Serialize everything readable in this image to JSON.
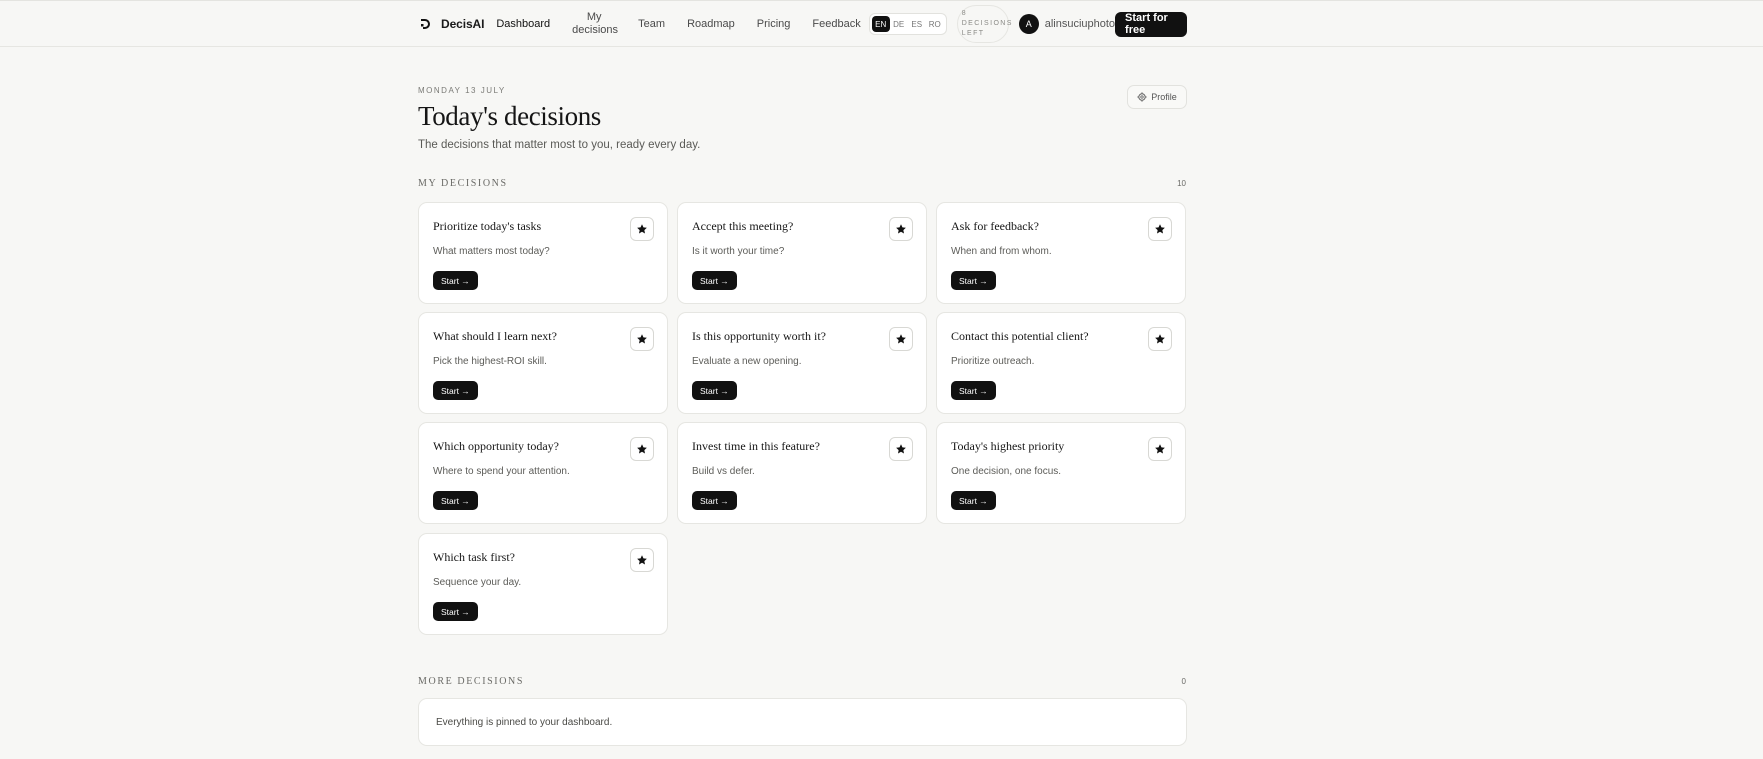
{
  "nav": {
    "brand": "DecisAI",
    "links": [
      {
        "label": "Dashboard"
      },
      {
        "label": "My decisions"
      },
      {
        "label": "Team"
      },
      {
        "label": "Roadmap"
      },
      {
        "label": "Pricing"
      },
      {
        "label": "Feedback"
      }
    ],
    "languages": [
      "EN",
      "DE",
      "ES",
      "RO"
    ],
    "active_language": "EN",
    "decisions_left_count": "8",
    "decisions_left_label_1": "DECISIONS",
    "decisions_left_label_2": "LEFT",
    "avatar_initial": "A",
    "username": "alinsuciuphoto",
    "cta_label": "Start for free"
  },
  "header": {
    "date": "MONDAY 13 JULY",
    "title": "Today's decisions",
    "subtitle": "The decisions that matter most to you, ready every day.",
    "profile_label": "Profile"
  },
  "my_decisions": {
    "label": "MY DECISIONS",
    "count": "10",
    "start_label": "Start →",
    "cards": [
      {
        "title": "Prioritize today's tasks",
        "subtitle": "What matters most today?"
      },
      {
        "title": "Accept this meeting?",
        "subtitle": "Is it worth your time?"
      },
      {
        "title": "Ask for feedback?",
        "subtitle": "When and from whom."
      },
      {
        "title": "What should I learn next?",
        "subtitle": "Pick the highest-ROI skill."
      },
      {
        "title": "Is this opportunity worth it?",
        "subtitle": "Evaluate a new opening."
      },
      {
        "title": "Contact this potential client?",
        "subtitle": "Prioritize outreach."
      },
      {
        "title": "Which opportunity today?",
        "subtitle": "Where to spend your attention."
      },
      {
        "title": "Invest time in this feature?",
        "subtitle": "Build vs defer."
      },
      {
        "title": "Today's highest priority",
        "subtitle": "One decision, one focus."
      },
      {
        "title": "Which task first?",
        "subtitle": "Sequence your day."
      }
    ]
  },
  "more_decisions": {
    "label": "MORE DECISIONS",
    "count": "0",
    "empty_text": "Everything is pinned to your dashboard."
  },
  "colors": {
    "background": "#f7f7f5",
    "accent": "#111111",
    "card": "#ffffff",
    "border": "#e6e6e2"
  }
}
